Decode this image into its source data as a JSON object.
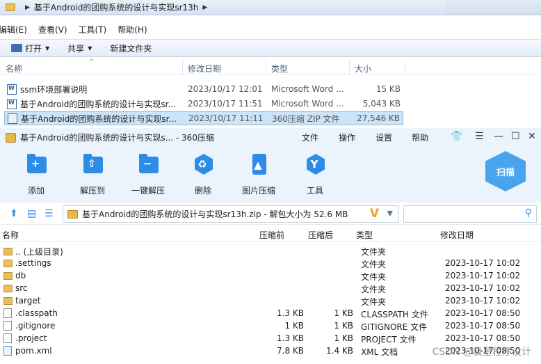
{
  "explorer": {
    "breadcrumb": "基于Android的团购系统的设计与实现sr13h",
    "menu": [
      "编辑(E)",
      "查看(V)",
      "工具(T)",
      "帮助(H)"
    ],
    "toolbar": {
      "open": "打开",
      "share": "共享",
      "new_folder": "新建文件夹"
    },
    "columns": {
      "name": "名称",
      "date": "修改日期",
      "type": "类型",
      "size": "大小"
    },
    "files": [
      {
        "name": "ssm环境部署说明",
        "date": "2023/10/17 12:01",
        "type": "Microsoft Word ...",
        "size": "15 KB",
        "icon": "word-doc-icon"
      },
      {
        "name": "基于Android的团购系统的设计与实现sr...",
        "date": "2023/10/17 11:51",
        "type": "Microsoft Word ...",
        "size": "5,043 KB",
        "icon": "word-doc-icon"
      },
      {
        "name": "基于Android的团购系统的设计与实现sr...",
        "date": "2023/10/17 11:11",
        "type": "360压缩 ZIP 文件",
        "size": "27,546 KB",
        "icon": "zip-file-icon",
        "selected": true
      }
    ]
  },
  "zip": {
    "title": "基于Android的团购系统的设计与实现s... - 360压缩",
    "menu": [
      "文件",
      "操作",
      "设置",
      "帮助"
    ],
    "ribbon": {
      "add": "添加",
      "extract_to": "解压到",
      "one_click": "一键解压",
      "delete": "删除",
      "image_compress": "图片压缩",
      "tools": "工具",
      "scan": "扫描"
    },
    "path": "基于Android的团购系统的设计与实现sr13h.zip - 解包大小为 52.6 MB",
    "columns": {
      "name": "名称",
      "compressed": "压缩前",
      "original": "压缩后",
      "type": "类型",
      "modified": "修改日期"
    },
    "rows": [
      {
        "name": ".. (上级目录)",
        "compressed": "",
        "original": "",
        "type": "文件夹",
        "modified": "",
        "icon": "folder-icon"
      },
      {
        "name": ".settings",
        "compressed": "",
        "original": "",
        "type": "文件夹",
        "modified": "2023-10-17 10:02",
        "icon": "folder-icon"
      },
      {
        "name": "db",
        "compressed": "",
        "original": "",
        "type": "文件夹",
        "modified": "2023-10-17 10:02",
        "icon": "folder-icon"
      },
      {
        "name": "src",
        "compressed": "",
        "original": "",
        "type": "文件夹",
        "modified": "2023-10-17 10:02",
        "icon": "folder-icon"
      },
      {
        "name": "target",
        "compressed": "",
        "original": "",
        "type": "文件夹",
        "modified": "2023-10-17 10:02",
        "icon": "folder-icon"
      },
      {
        "name": ".classpath",
        "compressed": "1.3 KB",
        "original": "1 KB",
        "type": "CLASSPATH 文件",
        "modified": "2023-10-17 08:50",
        "icon": "file-icon"
      },
      {
        "name": ".gitignore",
        "compressed": "1 KB",
        "original": "1 KB",
        "type": "GITIGNORE 文件",
        "modified": "2023-10-17 08:50",
        "icon": "file-icon"
      },
      {
        "name": ".project",
        "compressed": "1.3 KB",
        "original": "1 KB",
        "type": "PROJECT 文件",
        "modified": "2023-10-17 08:50",
        "icon": "file-icon"
      },
      {
        "name": "pom.xml",
        "compressed": "7.8 KB",
        "original": "1.4 KB",
        "type": "XML 文档",
        "modified": "2023-10-17 08:50",
        "icon": "xml-file-icon"
      }
    ]
  },
  "watermark": "CSDN @极星程序设计"
}
